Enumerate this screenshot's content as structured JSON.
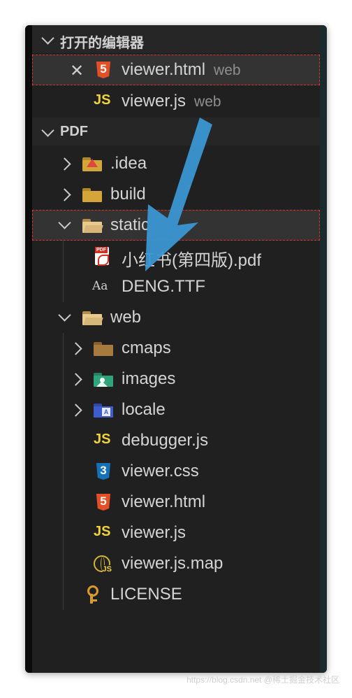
{
  "open_editors": {
    "title": "打开的编辑器",
    "items": [
      {
        "name": "viewer.html",
        "folder": "web",
        "icon": "html5-icon",
        "active": true
      },
      {
        "name": "viewer.js",
        "folder": "web",
        "icon": "js-icon",
        "active": false
      }
    ]
  },
  "explorer": {
    "root": "PDF",
    "items": [
      {
        "label": ".idea",
        "icon": "idea-folder-icon"
      },
      {
        "label": "build",
        "icon": "build-folder-icon"
      },
      {
        "label": "static",
        "icon": "open-folder-icon"
      },
      {
        "label": "小红书(第四版).pdf",
        "icon": "pdf-icon"
      },
      {
        "label": "DENG.TTF",
        "icon": "font-icon"
      },
      {
        "label": "web",
        "icon": "open-folder-icon"
      },
      {
        "label": "cmaps",
        "icon": "folder-icon"
      },
      {
        "label": "images",
        "icon": "images-folder-icon"
      },
      {
        "label": "locale",
        "icon": "locale-folder-icon"
      },
      {
        "label": "debugger.js",
        "icon": "js-icon"
      },
      {
        "label": "viewer.css",
        "icon": "css3-icon"
      },
      {
        "label": "viewer.html",
        "icon": "html5-icon"
      },
      {
        "label": "viewer.js",
        "icon": "js-icon"
      },
      {
        "label": "viewer.js.map",
        "icon": "map-icon"
      },
      {
        "label": "LICENSE",
        "icon": "license-key-icon"
      }
    ]
  },
  "icons": {
    "html5": "5",
    "css3": "3",
    "js": "JS",
    "font": "Aa",
    "pdf": "PDF",
    "locale": "A",
    "map_js": "JS"
  },
  "watermark": "https://blog.csdn.net @稀土掘金技术社区",
  "colors": {
    "accent_arrow": "#3b97d3",
    "selection_outline": "#e0322a",
    "js_yellow": "#f2d33c",
    "html_orange": "#e34f26",
    "css_blue": "#1572b6"
  }
}
